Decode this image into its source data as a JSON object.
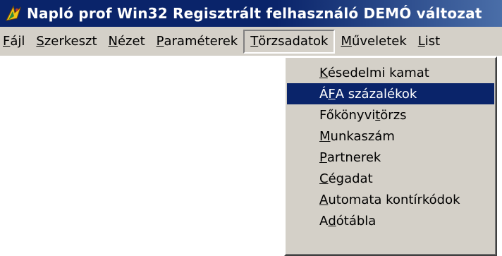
{
  "window": {
    "title": "Napló prof Win32 Regisztrált felhasználó  DEMÓ változat",
    "icon": "app-icon"
  },
  "menubar": {
    "items": [
      {
        "pre": "",
        "acc": "F",
        "post": "ájl"
      },
      {
        "pre": "",
        "acc": "S",
        "post": "zerkeszt"
      },
      {
        "pre": "",
        "acc": "N",
        "post": "ézet"
      },
      {
        "pre": "",
        "acc": "P",
        "post": "araméterek"
      },
      {
        "pre": "",
        "acc": "T",
        "post": "örzsadatok"
      },
      {
        "pre": "",
        "acc": "M",
        "post": "űveletek"
      },
      {
        "pre": "",
        "acc": "L",
        "post": "ist"
      }
    ],
    "active_index": 4
  },
  "dropdown": {
    "items": [
      {
        "pre": "",
        "acc": "K",
        "post": "ésedelmi kamat"
      },
      {
        "pre": "Á",
        "acc": "F",
        "post": "A százalékok"
      },
      {
        "pre": "Főkönyvi ",
        "acc": "t",
        "post": "örzs"
      },
      {
        "pre": "",
        "acc": "M",
        "post": "unkaszám"
      },
      {
        "pre": "",
        "acc": "P",
        "post": "artnerek"
      },
      {
        "pre": "",
        "acc": "C",
        "post": "égadat"
      },
      {
        "pre": "",
        "acc": "A",
        "post": "utomata kontírkódok"
      },
      {
        "pre": "A",
        "acc": "d",
        "post": "ótábla"
      }
    ],
    "selected_index": 1
  },
  "colors": {
    "titlebar": "#0a246a",
    "menu_face": "#d4d0c8",
    "highlight": "#0a246a"
  }
}
